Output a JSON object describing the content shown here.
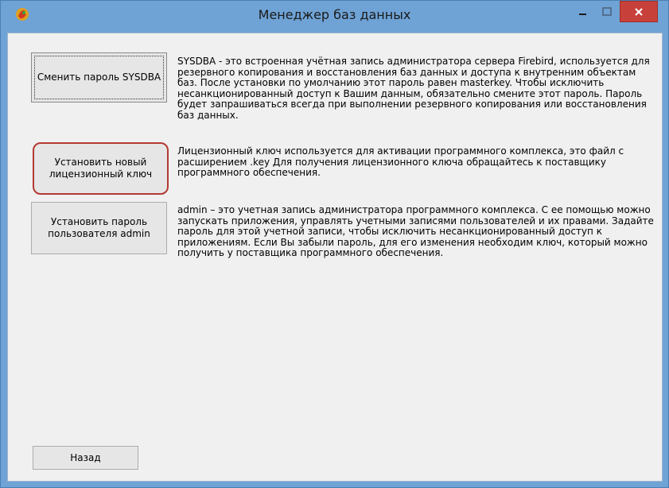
{
  "window": {
    "title": "Менеджер баз данных",
    "icons": {
      "app": "firebird-app-icon",
      "minimize": "minimize-icon",
      "maximize": "maximize-icon",
      "close": "close-icon"
    }
  },
  "buttons": {
    "sysdba": "Сменить пароль SYSDBA",
    "license": "Установить новый\nлицензионный ключ",
    "admin": "Установить пароль\nпользователя admin",
    "back": "Назад"
  },
  "descriptions": {
    "sysdba": "SYSDBA - это встроенная учётная запись администратора сервера Firebird, используется для резервного копирования и восстановления баз данных и доступа к внутренним объектам баз. После установки по умолчанию этот пароль равен masterkey. Чтобы исключить несанкционированный доступ к Вашим данным, обязательно смените этот пароль. Пароль будет запрашиваться всегда при выполнении резервного копирования или восстановления баз данных.",
    "license": "Лицензионный ключ используется для активации программного комплекса, это файл с расширением .key Для получения лицензионного ключа обращайтесь к поставщику программного обеспечения.",
    "admin": "admin – это учетная запись администратора программного комплекса. С ее помощью можно запускать приложения, управлять учетными записями пользователей и их правами. Задайте пароль для этой учетной записи, чтобы исключить несанкционированный доступ к приложениям. Если Вы забыли пароль, для его изменения необходим ключ, который можно получить у поставщика программного обеспечения."
  },
  "colors": {
    "frame": "#6fa3d6",
    "close": "#c7413a",
    "highlight": "#b33a33"
  }
}
